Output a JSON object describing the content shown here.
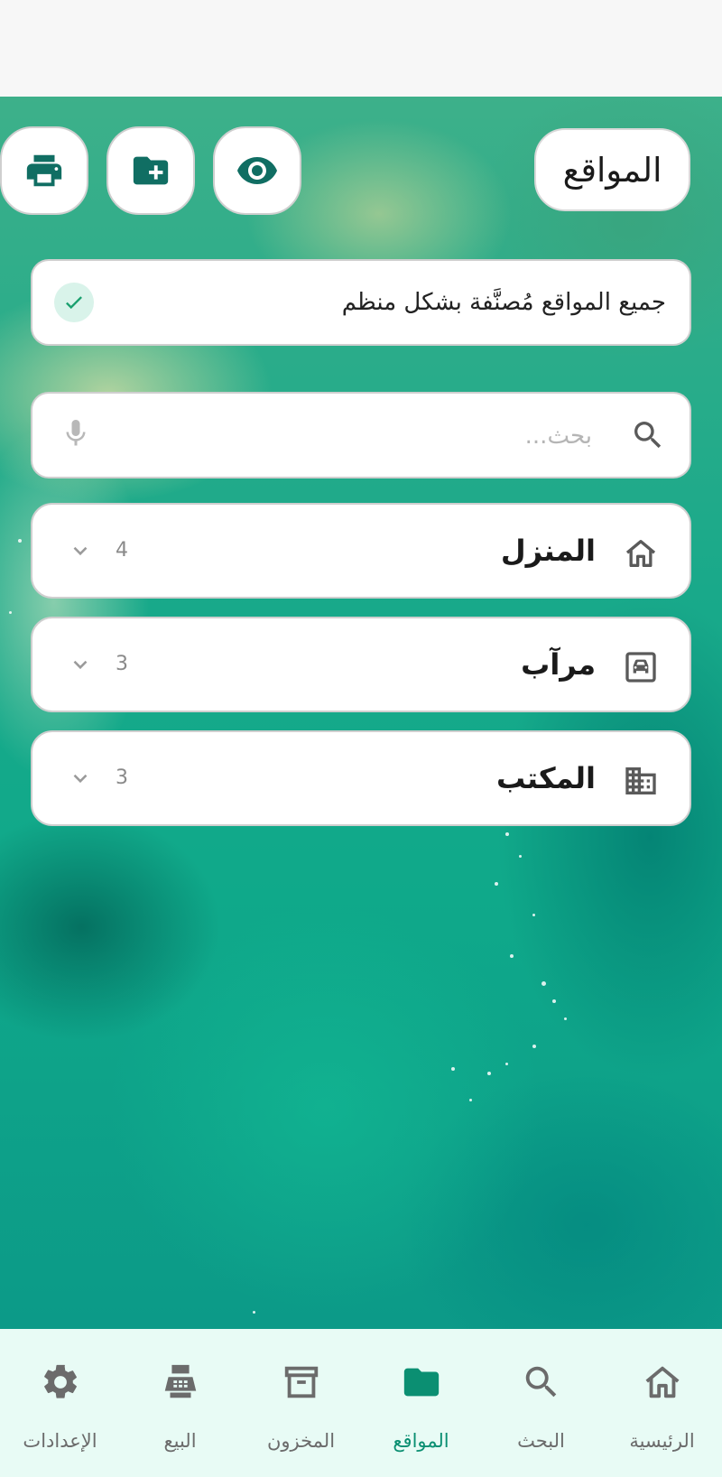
{
  "header": {
    "title": "المواقع"
  },
  "toolbar": {
    "print_icon": "print-icon",
    "new_folder_icon": "folder-plus-icon",
    "view_icon": "eye-icon"
  },
  "status": {
    "text": "جميع المواقع مُصنَّفة بشكل منظم",
    "icon": "check-icon"
  },
  "search": {
    "placeholder": "بحث...",
    "value": ""
  },
  "locations": [
    {
      "label": "المنزل",
      "count": "4",
      "icon": "home-icon"
    },
    {
      "label": "مرآب",
      "count": "3",
      "icon": "garage-icon"
    },
    {
      "label": "المكتب",
      "count": "3",
      "icon": "office-building-icon"
    }
  ],
  "nav": {
    "items": [
      {
        "label": "الرئيسية",
        "icon": "home-icon",
        "active": false
      },
      {
        "label": "البحث",
        "icon": "search-icon",
        "active": false
      },
      {
        "label": "المواقع",
        "icon": "folder-icon",
        "active": true
      },
      {
        "label": "المخزون",
        "icon": "archive-icon",
        "active": false
      },
      {
        "label": "البيع",
        "icon": "cash-register-icon",
        "active": false
      },
      {
        "label": "الإعدادات",
        "icon": "gear-icon",
        "active": false
      }
    ]
  },
  "colors": {
    "accent": "#0b8f72",
    "icon_dark": "#106e63",
    "nav_bg": "#e8fbf5"
  }
}
